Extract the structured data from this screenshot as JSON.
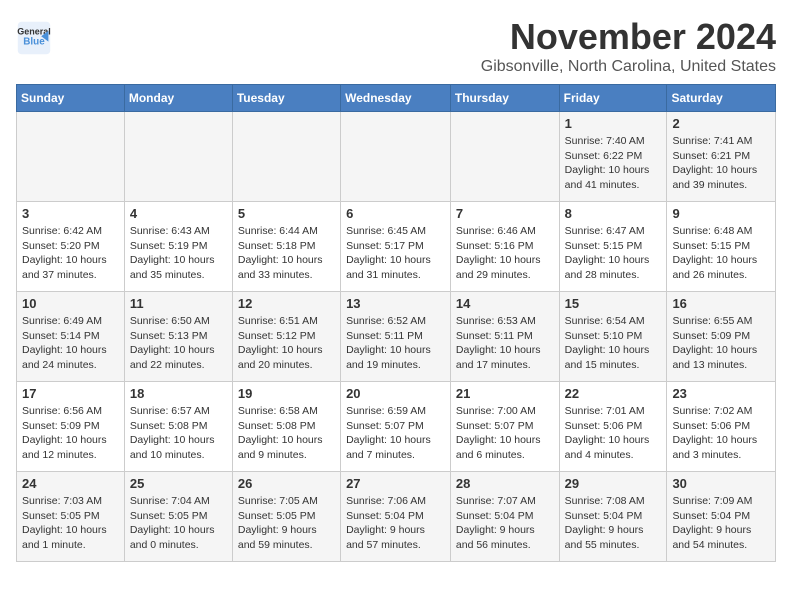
{
  "header": {
    "logo_line1": "General",
    "logo_line2": "Blue",
    "month_title": "November 2024",
    "location": "Gibsonville, North Carolina, United States"
  },
  "weekdays": [
    "Sunday",
    "Monday",
    "Tuesday",
    "Wednesday",
    "Thursday",
    "Friday",
    "Saturday"
  ],
  "weeks": [
    [
      {
        "day": "",
        "info": ""
      },
      {
        "day": "",
        "info": ""
      },
      {
        "day": "",
        "info": ""
      },
      {
        "day": "",
        "info": ""
      },
      {
        "day": "",
        "info": ""
      },
      {
        "day": "1",
        "info": "Sunrise: 7:40 AM\nSunset: 6:22 PM\nDaylight: 10 hours\nand 41 minutes."
      },
      {
        "day": "2",
        "info": "Sunrise: 7:41 AM\nSunset: 6:21 PM\nDaylight: 10 hours\nand 39 minutes."
      }
    ],
    [
      {
        "day": "3",
        "info": "Sunrise: 6:42 AM\nSunset: 5:20 PM\nDaylight: 10 hours\nand 37 minutes."
      },
      {
        "day": "4",
        "info": "Sunrise: 6:43 AM\nSunset: 5:19 PM\nDaylight: 10 hours\nand 35 minutes."
      },
      {
        "day": "5",
        "info": "Sunrise: 6:44 AM\nSunset: 5:18 PM\nDaylight: 10 hours\nand 33 minutes."
      },
      {
        "day": "6",
        "info": "Sunrise: 6:45 AM\nSunset: 5:17 PM\nDaylight: 10 hours\nand 31 minutes."
      },
      {
        "day": "7",
        "info": "Sunrise: 6:46 AM\nSunset: 5:16 PM\nDaylight: 10 hours\nand 29 minutes."
      },
      {
        "day": "8",
        "info": "Sunrise: 6:47 AM\nSunset: 5:15 PM\nDaylight: 10 hours\nand 28 minutes."
      },
      {
        "day": "9",
        "info": "Sunrise: 6:48 AM\nSunset: 5:15 PM\nDaylight: 10 hours\nand 26 minutes."
      }
    ],
    [
      {
        "day": "10",
        "info": "Sunrise: 6:49 AM\nSunset: 5:14 PM\nDaylight: 10 hours\nand 24 minutes."
      },
      {
        "day": "11",
        "info": "Sunrise: 6:50 AM\nSunset: 5:13 PM\nDaylight: 10 hours\nand 22 minutes."
      },
      {
        "day": "12",
        "info": "Sunrise: 6:51 AM\nSunset: 5:12 PM\nDaylight: 10 hours\nand 20 minutes."
      },
      {
        "day": "13",
        "info": "Sunrise: 6:52 AM\nSunset: 5:11 PM\nDaylight: 10 hours\nand 19 minutes."
      },
      {
        "day": "14",
        "info": "Sunrise: 6:53 AM\nSunset: 5:11 PM\nDaylight: 10 hours\nand 17 minutes."
      },
      {
        "day": "15",
        "info": "Sunrise: 6:54 AM\nSunset: 5:10 PM\nDaylight: 10 hours\nand 15 minutes."
      },
      {
        "day": "16",
        "info": "Sunrise: 6:55 AM\nSunset: 5:09 PM\nDaylight: 10 hours\nand 13 minutes."
      }
    ],
    [
      {
        "day": "17",
        "info": "Sunrise: 6:56 AM\nSunset: 5:09 PM\nDaylight: 10 hours\nand 12 minutes."
      },
      {
        "day": "18",
        "info": "Sunrise: 6:57 AM\nSunset: 5:08 PM\nDaylight: 10 hours\nand 10 minutes."
      },
      {
        "day": "19",
        "info": "Sunrise: 6:58 AM\nSunset: 5:08 PM\nDaylight: 10 hours\nand 9 minutes."
      },
      {
        "day": "20",
        "info": "Sunrise: 6:59 AM\nSunset: 5:07 PM\nDaylight: 10 hours\nand 7 minutes."
      },
      {
        "day": "21",
        "info": "Sunrise: 7:00 AM\nSunset: 5:07 PM\nDaylight: 10 hours\nand 6 minutes."
      },
      {
        "day": "22",
        "info": "Sunrise: 7:01 AM\nSunset: 5:06 PM\nDaylight: 10 hours\nand 4 minutes."
      },
      {
        "day": "23",
        "info": "Sunrise: 7:02 AM\nSunset: 5:06 PM\nDaylight: 10 hours\nand 3 minutes."
      }
    ],
    [
      {
        "day": "24",
        "info": "Sunrise: 7:03 AM\nSunset: 5:05 PM\nDaylight: 10 hours\nand 1 minute."
      },
      {
        "day": "25",
        "info": "Sunrise: 7:04 AM\nSunset: 5:05 PM\nDaylight: 10 hours\nand 0 minutes."
      },
      {
        "day": "26",
        "info": "Sunrise: 7:05 AM\nSunset: 5:05 PM\nDaylight: 9 hours\nand 59 minutes."
      },
      {
        "day": "27",
        "info": "Sunrise: 7:06 AM\nSunset: 5:04 PM\nDaylight: 9 hours\nand 57 minutes."
      },
      {
        "day": "28",
        "info": "Sunrise: 7:07 AM\nSunset: 5:04 PM\nDaylight: 9 hours\nand 56 minutes."
      },
      {
        "day": "29",
        "info": "Sunrise: 7:08 AM\nSunset: 5:04 PM\nDaylight: 9 hours\nand 55 minutes."
      },
      {
        "day": "30",
        "info": "Sunrise: 7:09 AM\nSunset: 5:04 PM\nDaylight: 9 hours\nand 54 minutes."
      }
    ]
  ]
}
